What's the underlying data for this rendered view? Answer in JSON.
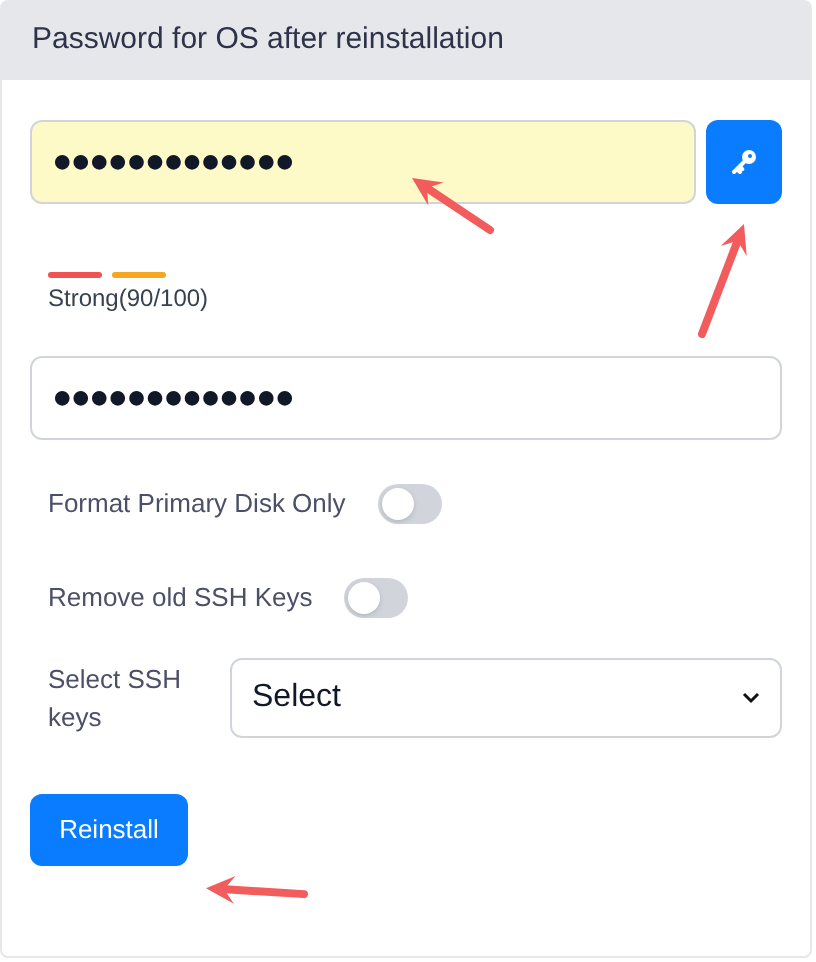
{
  "panel": {
    "title": "Password for OS after reinstallation"
  },
  "password": {
    "value": "●●●●●●●●●●●●●",
    "autofilled": true
  },
  "strength": {
    "segments": [
      {
        "color": "#f05252"
      },
      {
        "color": "#f5a623"
      }
    ],
    "label": "Strong(90/100)"
  },
  "confirm": {
    "value": "●●●●●●●●●●●●●"
  },
  "toggles": [
    {
      "label": "Format Primary Disk Only",
      "on": false
    },
    {
      "label": "Remove old SSH Keys",
      "on": false
    }
  ],
  "ssh_select": {
    "label": "Select SSH keys",
    "value": "Select"
  },
  "submit": {
    "label": "Reinstall"
  }
}
